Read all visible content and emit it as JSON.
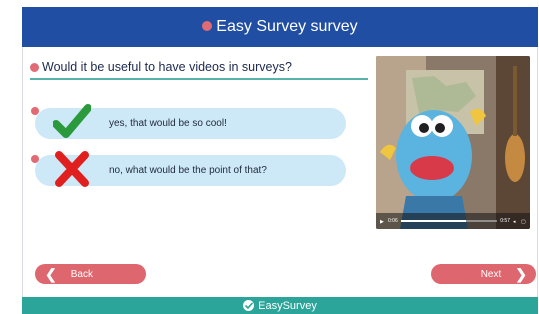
{
  "header": {
    "title": "Easy Survey survey"
  },
  "question": {
    "text": "Would it be useful to have videos in surveys?"
  },
  "answers": [
    {
      "label": "yes, that would be so cool!",
      "icon": "check-icon"
    },
    {
      "label": "no, what would be the point of that?",
      "icon": "cross-icon"
    }
  ],
  "video": {
    "current_time": "0:06",
    "duration": "0:57",
    "progress": 0.68
  },
  "nav": {
    "back_label": "Back",
    "next_label": "Next"
  },
  "footer": {
    "brand": "EasySurvey"
  },
  "colors": {
    "header": "#1f4ea3",
    "accent_red": "#de666e",
    "answer_bg": "#cde8f7",
    "footer": "#2ba49a",
    "check_green": "#2a9a3c",
    "cross_red": "#e0201f"
  }
}
